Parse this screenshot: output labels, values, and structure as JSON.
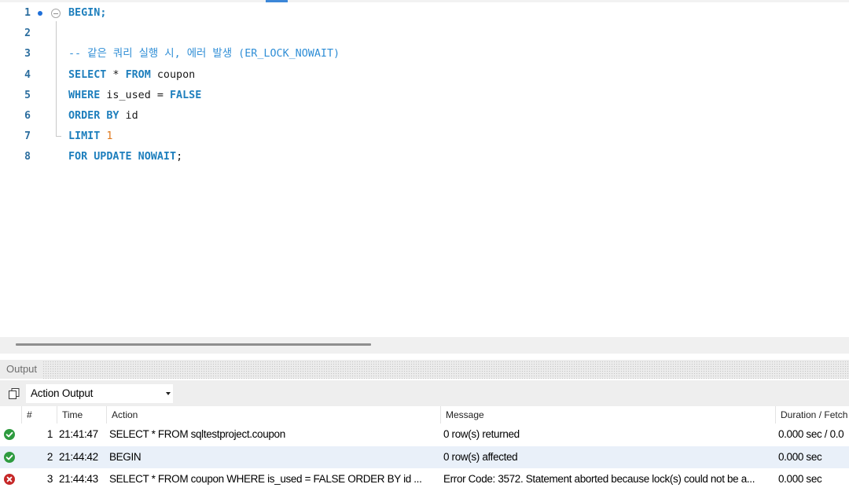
{
  "editor": {
    "lines": [
      {
        "num": "1",
        "tokens": [
          {
            "t": "BEGIN",
            "c": "kw"
          },
          {
            "t": ";",
            "c": "kw"
          }
        ]
      },
      {
        "num": "2",
        "tokens": []
      },
      {
        "num": "3",
        "tokens": [
          {
            "t": "-- 같은 쿼리 실행 시, 에러 발생 (ER_LOCK_NOWAIT)",
            "c": "cm"
          }
        ]
      },
      {
        "num": "4",
        "tokens": [
          {
            "t": "SELECT",
            "c": "kw"
          },
          {
            "t": " * ",
            "c": ""
          },
          {
            "t": "FROM",
            "c": "kw"
          },
          {
            "t": " coupon",
            "c": ""
          }
        ]
      },
      {
        "num": "5",
        "tokens": [
          {
            "t": "WHERE",
            "c": "kw"
          },
          {
            "t": " is_used = ",
            "c": ""
          },
          {
            "t": "FALSE",
            "c": "kw"
          }
        ]
      },
      {
        "num": "6",
        "tokens": [
          {
            "t": "ORDER BY",
            "c": "kw"
          },
          {
            "t": " id",
            "c": ""
          }
        ]
      },
      {
        "num": "7",
        "tokens": [
          {
            "t": "LIMIT",
            "c": "kw"
          },
          {
            "t": " ",
            "c": ""
          },
          {
            "t": "1",
            "c": "num"
          }
        ]
      },
      {
        "num": "8",
        "tokens": [
          {
            "t": "FOR UPDATE NOWAIT",
            "c": "kw"
          },
          {
            "t": ";",
            "c": ""
          }
        ]
      }
    ]
  },
  "output": {
    "title": "Output",
    "selector": {
      "selected": "Action Output"
    },
    "columns": {
      "num": "#",
      "time": "Time",
      "action": "Action",
      "message": "Message",
      "duration": "Duration / Fetch"
    },
    "rows": [
      {
        "num": "1",
        "time": "21:41:47",
        "action": "SELECT * FROM sqltestproject.coupon",
        "message": "0 row(s) returned",
        "duration": "0.000 sec / 0.0",
        "status": "ok"
      },
      {
        "num": "2",
        "time": "21:44:42",
        "action": "BEGIN",
        "message": "0 row(s) affected",
        "duration": "0.000 sec",
        "status": "ok"
      },
      {
        "num": "3",
        "time": "21:44:43",
        "action": "SELECT * FROM coupon WHERE is_used = FALSE ORDER BY id ...",
        "message": "Error Code: 3572. Statement aborted because lock(s) could not be a...",
        "duration": "0.000 sec",
        "status": "error"
      }
    ]
  },
  "colors": {
    "ok": "#2e9b3f",
    "error": "#c62828",
    "keyword": "#1e7fbd",
    "number": "#e07a1f",
    "comment": "#2f8ed6"
  }
}
